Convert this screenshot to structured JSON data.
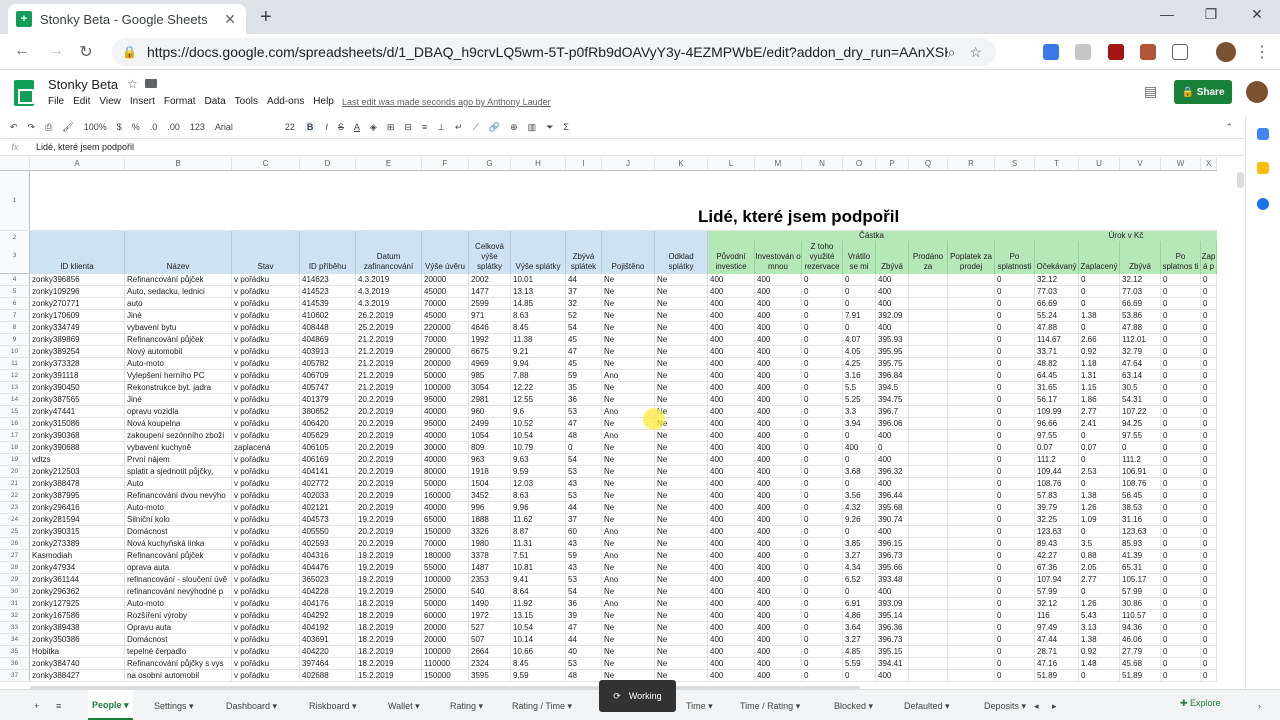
{
  "browser": {
    "tab_title": "Stonky Beta - Google Sheets",
    "url": "https://docs.google.com/spreadsheets/d/1_DBAQ_h9crvLQ5wm-5T-p0fRb9dOAVyY3y-4EZMPWbE/edit?addon_dry_run=AAnXSK-...",
    "colors": {
      "sheets_green": "#0f9d58",
      "share_green": "#188038"
    }
  },
  "doc": {
    "title": "Stonky Beta",
    "menus": [
      "File",
      "Edit",
      "View",
      "Insert",
      "Format",
      "Data",
      "Tools",
      "Add-ons",
      "Help"
    ],
    "last_edit": "Last edit was made seconds ago by Anthony Lauder",
    "share_label": "Share"
  },
  "toolbar": {
    "zoom": "100%",
    "currency": "$",
    "percent": "%",
    "dec_less": ".0",
    "dec_more": ".00",
    "format_more": "123",
    "font": "Arial",
    "font_size": "22",
    "bold": "B",
    "italic": "I",
    "strike": "S",
    "text_color": "A",
    "sum": "Σ"
  },
  "formula_bar": {
    "fx": "fx",
    "value": "Lidé, které jsem podpořil"
  },
  "columns": [
    "A",
    "B",
    "C",
    "D",
    "E",
    "F",
    "G",
    "H",
    "I",
    "J",
    "K",
    "L",
    "M",
    "N",
    "O",
    "P",
    "Q",
    "R",
    "S",
    "T",
    "U",
    "V",
    "W",
    "X"
  ],
  "sheet_title": "Lidé, které jsem podpořil",
  "group_castka": "Částka",
  "group_urok": "Úrok v Kč",
  "headers": [
    "ID klienta",
    "Název",
    "Stav",
    "ID příběhu",
    "Datum zafinancování",
    "Výše úvěru",
    "Celková výše splátky",
    "Výše splátky",
    "Zbývá splátek",
    "Pojištěno",
    "Odklad splátky",
    "Původní investice",
    "Investován o mnou",
    "Z toho využité rezervace",
    "Vrátilo se mi",
    "Zbývá",
    "Prodáno za",
    "Poplatek za prodej",
    "Po splatnosti",
    "Očekávaný",
    "Zaplacený",
    "Zbývá",
    "Po splatnos ti",
    "Zap á p"
  ],
  "rows": [
    [
      "4",
      "zonky396856",
      "Refinancování půjček",
      "v pořádku",
      "414623",
      "4.3.2019",
      "20000",
      "2002",
      "10.01",
      "44",
      "Ne",
      "Ne",
      "400",
      "400",
      "0",
      "0",
      "400",
      "",
      "",
      "0",
      "32.12",
      "0",
      "32.12",
      "0",
      "0"
    ],
    [
      "5",
      "zonky109296",
      "Auto, sedacku, lednici",
      "v pořádku",
      "414523",
      "4.3.2019",
      "45000",
      "1477",
      "13.13",
      "37",
      "Ne",
      "Ne",
      "400",
      "400",
      "0",
      "0",
      "400",
      "",
      "",
      "0",
      "77.03",
      "0",
      "77.03",
      "0",
      "0"
    ],
    [
      "6",
      "zonky270771",
      "auto",
      "v pořádku",
      "414539",
      "4.3.2019",
      "70000",
      "2599",
      "14.85",
      "32",
      "Ne",
      "Ne",
      "400",
      "400",
      "0",
      "0",
      "400",
      "",
      "",
      "0",
      "66.69",
      "0",
      "66.69",
      "0",
      "0"
    ],
    [
      "7",
      "zonky170609",
      "Jiné",
      "v pořádku",
      "410602",
      "26.2.2019",
      "45000",
      "971",
      "8.63",
      "52",
      "Ne",
      "Ne",
      "400",
      "400",
      "0",
      "7.91",
      "392.09",
      "",
      "",
      "0",
      "55.24",
      "1.38",
      "53.86",
      "0",
      "0"
    ],
    [
      "8",
      "zonky334749",
      "vybavení bytu",
      "v pořádku",
      "408448",
      "25.2.2019",
      "220000",
      "4646",
      "8.45",
      "54",
      "Ne",
      "Ne",
      "400",
      "400",
      "0",
      "0",
      "400",
      "",
      "",
      "0",
      "47.88",
      "0",
      "47.88",
      "0",
      "0"
    ],
    [
      "9",
      "zonky389869",
      "Refinancování půjček",
      "v pořádku",
      "404869",
      "21.2.2019",
      "70000",
      "1992",
      "11.38",
      "45",
      "Ne",
      "Ne",
      "400",
      "400",
      "0",
      "4.07",
      "395.93",
      "",
      "",
      "0",
      "114.67",
      "2.66",
      "112.01",
      "0",
      "0"
    ],
    [
      "10",
      "zonky389254",
      "Nový automobil",
      "v pořádku",
      "403913",
      "21.2.2019",
      "290000",
      "6675",
      "9.21",
      "47",
      "Ne",
      "Ne",
      "400",
      "400",
      "0",
      "4.05",
      "395.95",
      "",
      "",
      "0",
      "33.71",
      "0.92",
      "32.79",
      "0",
      "0"
    ],
    [
      "11",
      "zonky373328",
      "Auto-moto",
      "v pořádku",
      "405782",
      "21.2.2019",
      "200000",
      "4969",
      "9.94",
      "45",
      "Ne",
      "Ne",
      "400",
      "400",
      "0",
      "4.25",
      "395.75",
      "",
      "",
      "0",
      "48.82",
      "1.18",
      "47.64",
      "0",
      "0"
    ],
    [
      "12",
      "zonky391118",
      "Vylepšení herního PC",
      "v pořádku",
      "406709",
      "21.2.2019",
      "50000",
      "985",
      "7.88",
      "59",
      "Ano",
      "Ne",
      "400",
      "400",
      "0",
      "3.16",
      "396.84",
      "",
      "",
      "0",
      "64.45",
      "1.31",
      "63.14",
      "0",
      "0"
    ],
    [
      "13",
      "zonky390450",
      "Rekonstrukce byt. jadra",
      "v pořádku",
      "405747",
      "21.2.2019",
      "100000",
      "3054",
      "12.22",
      "35",
      "Ne",
      "Ne",
      "400",
      "400",
      "0",
      "5.5",
      "394.5",
      "",
      "",
      "0",
      "31.65",
      "1.15",
      "30.5",
      "0",
      "0"
    ],
    [
      "14",
      "zonky387565",
      "Jiné",
      "v pořádku",
      "401379",
      "20.2.2019",
      "95000",
      "2981",
      "12.55",
      "36",
      "Ne",
      "Ne",
      "400",
      "400",
      "0",
      "5.25",
      "394.75",
      "",
      "",
      "0",
      "56.17",
      "1.86",
      "54.31",
      "0",
      "0"
    ],
    [
      "15",
      "zonky47441",
      "opravu vozidla",
      "v pořádku",
      "380652",
      "20.2.2019",
      "40000",
      "960",
      "9.6",
      "53",
      "Ano",
      "Ne",
      "400",
      "400",
      "0",
      "3.3",
      "396.7",
      "",
      "",
      "0",
      "109.99",
      "2.77",
      "107.22",
      "0",
      "0"
    ],
    [
      "16",
      "zonky315086",
      "Nová koupelna",
      "v pořádku",
      "406420",
      "20.2.2019",
      "95000",
      "2499",
      "10.52",
      "47",
      "Ne",
      "Ne",
      "400",
      "400",
      "0",
      "3.94",
      "396.06",
      "",
      "",
      "0",
      "96.66",
      "2.41",
      "94.25",
      "0",
      "0"
    ],
    [
      "17",
      "zonky390368",
      "zakoupení sezónního zboží",
      "v pořádku",
      "405629",
      "20.2.2019",
      "40000",
      "1054",
      "10.54",
      "48",
      "Ano",
      "Ne",
      "400",
      "400",
      "0",
      "0",
      "400",
      "",
      "",
      "0",
      "97.55",
      "0",
      "97.55",
      "0",
      "0"
    ],
    [
      "18",
      "zonky390688",
      "vybavení kuchyně",
      "zaplacená",
      "406105",
      "20.2.2019",
      "30000",
      "809",
      "10.79",
      "0",
      "Ne",
      "Ne",
      "400",
      "400",
      "0",
      "400",
      "0",
      "",
      "",
      "0",
      "0.07",
      "0.07",
      "0",
      "0",
      "0"
    ],
    [
      "19",
      "vdtzs",
      "První nájem",
      "v pořádku",
      "406169",
      "20.2.2019",
      "40000",
      "963",
      "9.63",
      "54",
      "Ne",
      "Ne",
      "400",
      "400",
      "0",
      "0",
      "400",
      "",
      "",
      "0",
      "111.2",
      "0",
      "111.2",
      "0",
      "0"
    ],
    [
      "20",
      "zonky212503",
      "splatit a sjednotit půjčky,",
      "v pořádku",
      "404141",
      "20.2.2019",
      "80000",
      "1918",
      "9.59",
      "53",
      "Ne",
      "Ne",
      "400",
      "400",
      "0",
      "3.68",
      "396.32",
      "",
      "",
      "0",
      "109.44",
      "2.53",
      "106.91",
      "0",
      "0"
    ],
    [
      "21",
      "zonky388478",
      "Auto",
      "v pořádku",
      "402772",
      "20.2.2019",
      "50000",
      "1504",
      "12.03",
      "43",
      "Ne",
      "Ne",
      "400",
      "400",
      "0",
      "0",
      "400",
      "",
      "",
      "0",
      "108.76",
      "0",
      "108.76",
      "0",
      "0"
    ],
    [
      "22",
      "zonky387995",
      "Refinancování dvou nevýho",
      "v pořádku",
      "402033",
      "20.2.2019",
      "160000",
      "3452",
      "8.63",
      "53",
      "Ne",
      "Ne",
      "400",
      "400",
      "0",
      "3.56",
      "396.44",
      "",
      "",
      "0",
      "57.83",
      "1.38",
      "56.45",
      "0",
      "0"
    ],
    [
      "23",
      "zonky296416",
      "Auto-moto",
      "v pořádku",
      "402121",
      "20.2.2019",
      "40000",
      "996",
      "9.96",
      "44",
      "Ne",
      "Ne",
      "400",
      "400",
      "0",
      "4.32",
      "395.68",
      "",
      "",
      "0",
      "39.79",
      "1.26",
      "38.53",
      "0",
      "0"
    ],
    [
      "24",
      "zonky281594",
      "Silniční kolo",
      "v pořádku",
      "404573",
      "19.2.2019",
      "65000",
      "1888",
      "11.62",
      "37",
      "Ne",
      "Ne",
      "400",
      "400",
      "0",
      "9.26",
      "390.74",
      "",
      "",
      "0",
      "32.25",
      "1.09",
      "31.16",
      "0",
      "0"
    ],
    [
      "25",
      "zonky390315",
      "Domácnost",
      "v pořádku",
      "405550",
      "20.2.2019",
      "150000",
      "3326",
      "8.87",
      "60",
      "Ano",
      "Ne",
      "400",
      "400",
      "0",
      "0",
      "400",
      "",
      "",
      "0",
      "123.63",
      "0",
      "123.63",
      "0",
      "0"
    ],
    [
      "26",
      "zonky273389",
      "Nová kuchyňská linka",
      "v pořádku",
      "402593",
      "20.2.2019",
      "70000",
      "1980",
      "11.31",
      "43",
      "Ne",
      "Ne",
      "400",
      "400",
      "0",
      "3.85",
      "396.15",
      "",
      "",
      "0",
      "89.43",
      "3.5",
      "85.93",
      "0",
      "0"
    ],
    [
      "27",
      "Kasmodiah",
      "Refinancování půjček",
      "v pořádku",
      "404316",
      "19.2.2019",
      "180000",
      "3378",
      "7.51",
      "59",
      "Ano",
      "Ne",
      "400",
      "400",
      "0",
      "3.27",
      "396.73",
      "",
      "",
      "0",
      "42.27",
      "0.88",
      "41.39",
      "0",
      "0"
    ],
    [
      "28",
      "zonky47934",
      "oprava auta",
      "v pořádku",
      "404476",
      "19.2.2019",
      "55000",
      "1487",
      "10.81",
      "43",
      "Ne",
      "Ne",
      "400",
      "400",
      "0",
      "4.34",
      "395.66",
      "",
      "",
      "0",
      "67.36",
      "2.05",
      "65.31",
      "0",
      "0"
    ],
    [
      "29",
      "zonky361144",
      "refinancování - sloučení úvě",
      "v pořádku",
      "365023",
      "19.2.2019",
      "100000",
      "2353",
      "9.41",
      "53",
      "Ano",
      "Ne",
      "400",
      "400",
      "0",
      "6.52",
      "393.48",
      "",
      "",
      "0",
      "107.94",
      "2.77",
      "105.17",
      "0",
      "0"
    ],
    [
      "30",
      "zonky296362",
      "refinancování nevýhodné p",
      "v pořádku",
      "404228",
      "19.2.2019",
      "25000",
      "540",
      "8.64",
      "54",
      "Ne",
      "Ne",
      "400",
      "400",
      "0",
      "0",
      "400",
      "",
      "",
      "0",
      "57.99",
      "0",
      "57.99",
      "0",
      "0"
    ],
    [
      "31",
      "zonky127925",
      "Auto-moto",
      "v pořádku",
      "404176",
      "18.2.2019",
      "50000",
      "1490",
      "11.92",
      "36",
      "Ano",
      "Ne",
      "400",
      "400",
      "0",
      "6.91",
      "393.09",
      "",
      "",
      "0",
      "32.12",
      "1.26",
      "30.86",
      "0",
      "0"
    ],
    [
      "32",
      "zonky167586",
      "Rozšíření výroby",
      "v pořádku",
      "404292",
      "18.2.2019",
      "60000",
      "1972",
      "13.15",
      "39",
      "Ne",
      "Ne",
      "400",
      "400",
      "0",
      "4.86",
      "395.14",
      "",
      "",
      "0",
      "116",
      "5.43",
      "110.57",
      "0",
      "0"
    ],
    [
      "33",
      "zonky389438",
      "Opravu auta",
      "v pořádku",
      "404192",
      "18.2.2019",
      "20000",
      "527",
      "10.54",
      "47",
      "Ne",
      "Ne",
      "400",
      "400",
      "0",
      "3.64",
      "396.36",
      "",
      "",
      "0",
      "97.49",
      "3.13",
      "94.36",
      "0",
      "0"
    ],
    [
      "34",
      "zonky350386",
      "Domácnost",
      "v pořádku",
      "403691",
      "18.2.2019",
      "20000",
      "507",
      "10.14",
      "44",
      "Ne",
      "Ne",
      "400",
      "400",
      "0",
      "3.27",
      "396.73",
      "",
      "",
      "0",
      "47.44",
      "1.38",
      "46.06",
      "0",
      "0"
    ],
    [
      "35",
      "Hobitka",
      "tepelné čerpadlo",
      "v pořádku",
      "404220",
      "18.2.2019",
      "100000",
      "2664",
      "10.66",
      "40",
      "Ne",
      "Ne",
      "400",
      "400",
      "0",
      "4.85",
      "395.15",
      "",
      "",
      "0",
      "28.71",
      "0.92",
      "27.79",
      "0",
      "0"
    ],
    [
      "36",
      "zonky384740",
      "Refinancování půjčky s vys",
      "v pořádku",
      "397464",
      "18.2.2019",
      "110000",
      "2324",
      "8.45",
      "53",
      "Ne",
      "Ne",
      "400",
      "400",
      "0",
      "5.59",
      "394.41",
      "",
      "",
      "0",
      "47.16",
      "1.48",
      "45.68",
      "0",
      "0"
    ],
    [
      "37",
      "zonky388427",
      "na osobní automobil",
      "v pořádku",
      "402688",
      "15.2.2019",
      "150000",
      "3595",
      "9.59",
      "48",
      "Ne",
      "Ne",
      "400",
      "400",
      "0",
      "0",
      "400",
      "",
      "",
      "0",
      "51.89",
      "0",
      "51.89",
      "0",
      "0"
    ]
  ],
  "sheet_tabs": [
    "People",
    "Settings",
    "Dashboard",
    "Riskboard",
    "Wallet",
    "Rating",
    "Rating / Time",
    "Summary",
    "Time",
    "Time / Rating",
    "Blocked",
    "Defaulted",
    "Deposits"
  ],
  "explore_label": "Explore",
  "working_label": "Working"
}
